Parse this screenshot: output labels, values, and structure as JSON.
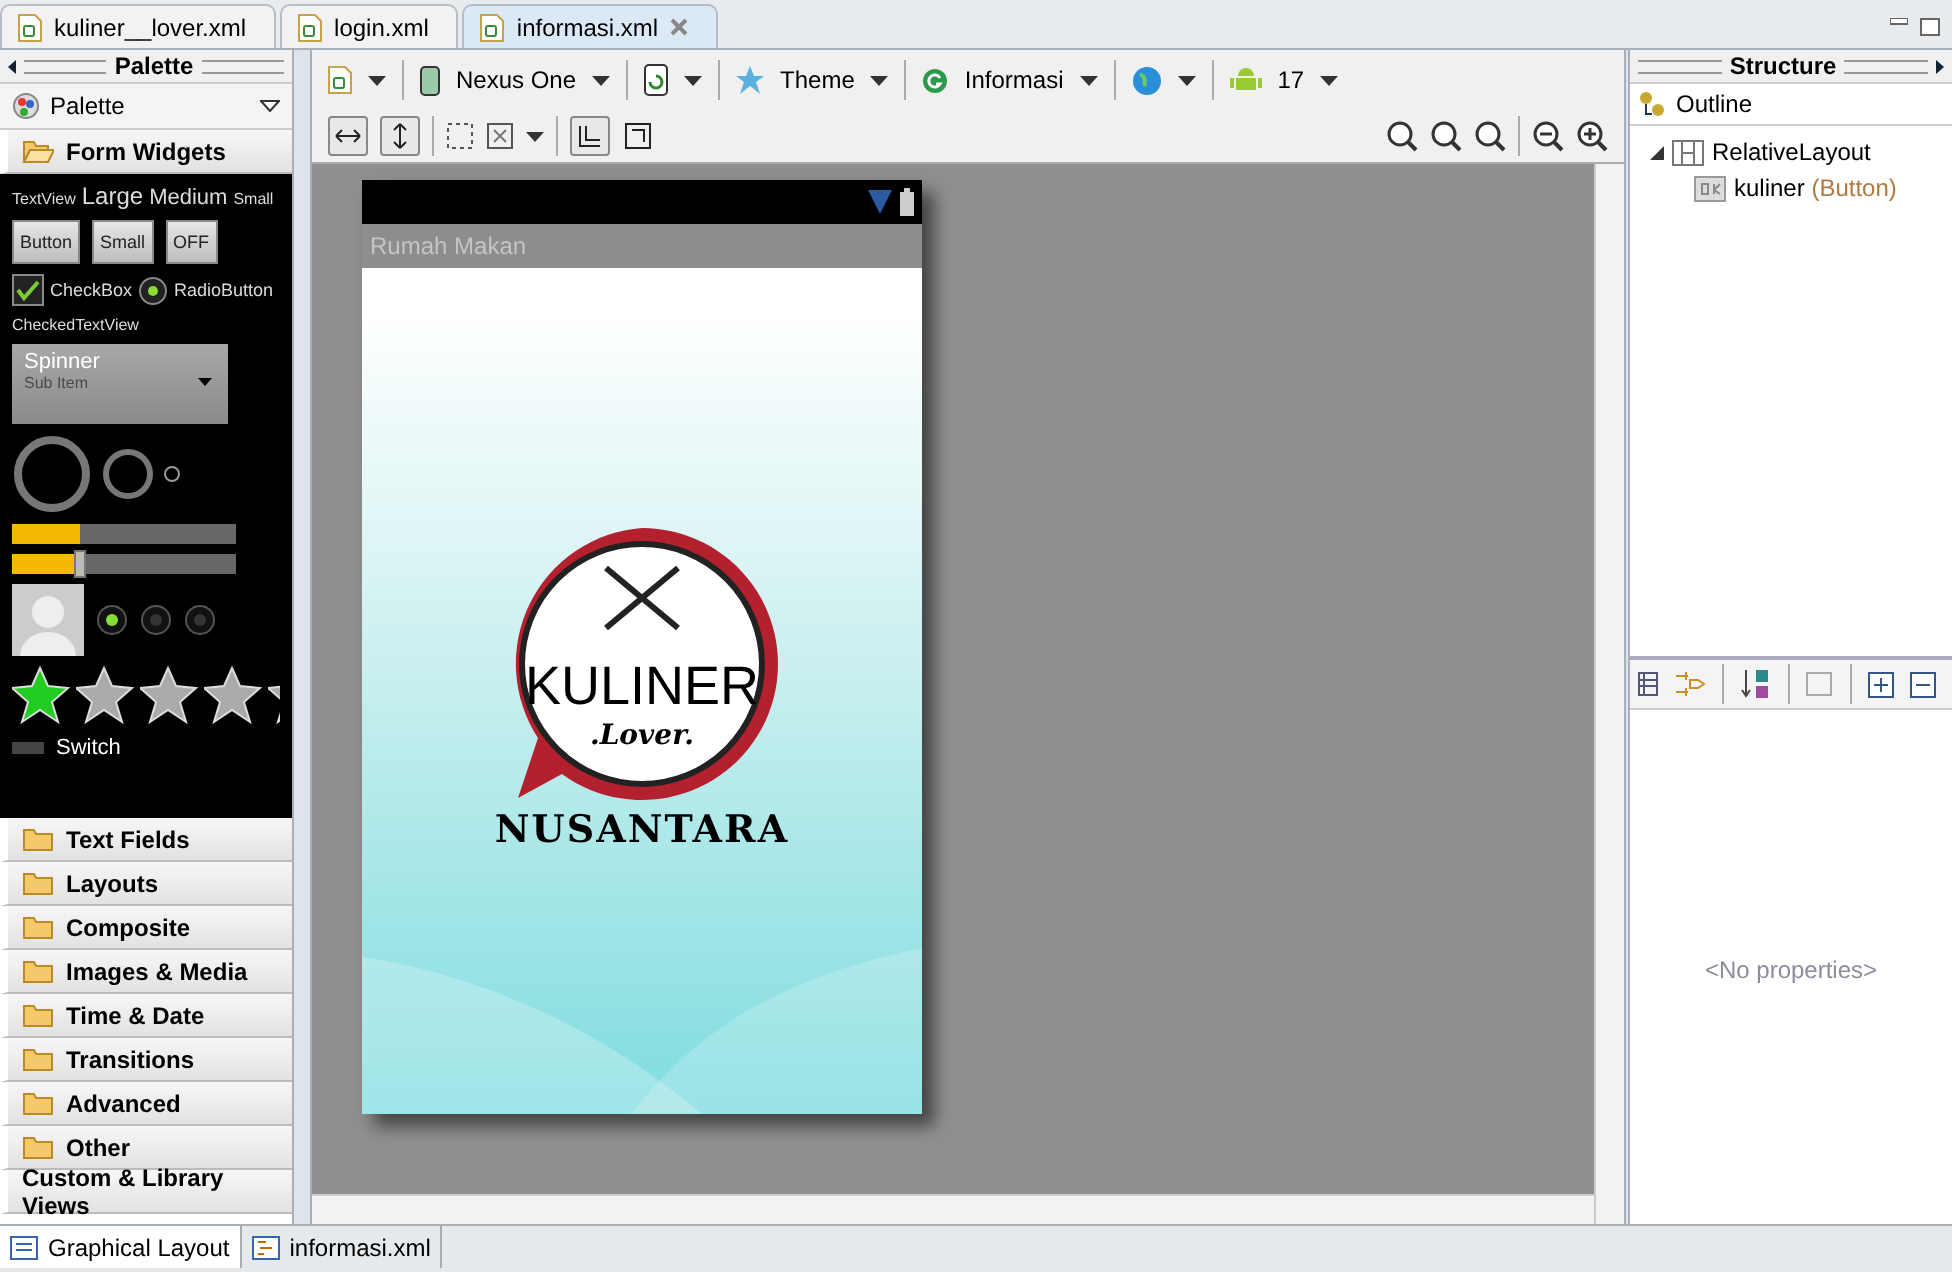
{
  "editor_tabs": [
    {
      "label": "kuliner__lover.xml",
      "selected": false
    },
    {
      "label": "login.xml",
      "selected": false
    },
    {
      "label": "informasi.xml",
      "selected": true
    }
  ],
  "palette": {
    "title": "Palette",
    "selector": "Palette",
    "categories": [
      {
        "label": "Form Widgets",
        "kind": "folder",
        "expanded": true
      },
      {
        "label": "Text Fields",
        "kind": "folder",
        "expanded": false
      },
      {
        "label": "Layouts",
        "kind": "folder",
        "expanded": false
      },
      {
        "label": "Composite",
        "kind": "folder",
        "expanded": false
      },
      {
        "label": "Images & Media",
        "kind": "folder",
        "expanded": false
      },
      {
        "label": "Time & Date",
        "kind": "folder",
        "expanded": false
      },
      {
        "label": "Transitions",
        "kind": "folder",
        "expanded": false
      },
      {
        "label": "Advanced",
        "kind": "folder",
        "expanded": false
      },
      {
        "label": "Other",
        "kind": "folder",
        "expanded": false
      },
      {
        "label": "Custom & Library Views",
        "kind": "plain",
        "expanded": false
      }
    ],
    "widgets": {
      "text_sizes": [
        "TextView",
        "Large",
        "Medium",
        "Small"
      ],
      "buttons": [
        "Button",
        "Small",
        "OFF"
      ],
      "checkbox": {
        "label": "CheckBox",
        "checked": true
      },
      "radio": {
        "label": "RadioButton",
        "selected": true
      },
      "checked_text": "CheckedTextView",
      "spinner": {
        "label": "Spinner",
        "sub": "Sub Item"
      },
      "progress": {
        "level": 0.3
      },
      "seekbar": {
        "level": 0.3
      },
      "radios": [
        {
          "selected": true
        },
        {
          "selected": false
        },
        {
          "selected": false
        }
      ],
      "rating": {
        "stars": 1
      },
      "switch": "Switch"
    }
  },
  "toolbar": {
    "device": "Nexus One",
    "theme": "Theme",
    "activity": "Informasi",
    "api": "17"
  },
  "phone": {
    "title": "Rumah Makan",
    "logo_word": "KULINER",
    "logo_sub": ".Lover.",
    "caption": "NUSANTARA"
  },
  "structure": {
    "title": "Structure",
    "outline": "Outline",
    "tree": [
      {
        "label": "RelativeLayout",
        "expanded": true,
        "children": [
          {
            "label": "kuliner",
            "type": "(Button)"
          }
        ]
      }
    ],
    "properties_empty": "<No properties>"
  },
  "bottom_tabs": [
    {
      "label": "Graphical Layout",
      "selected": true
    },
    {
      "label": "informasi.xml",
      "selected": false
    }
  ]
}
